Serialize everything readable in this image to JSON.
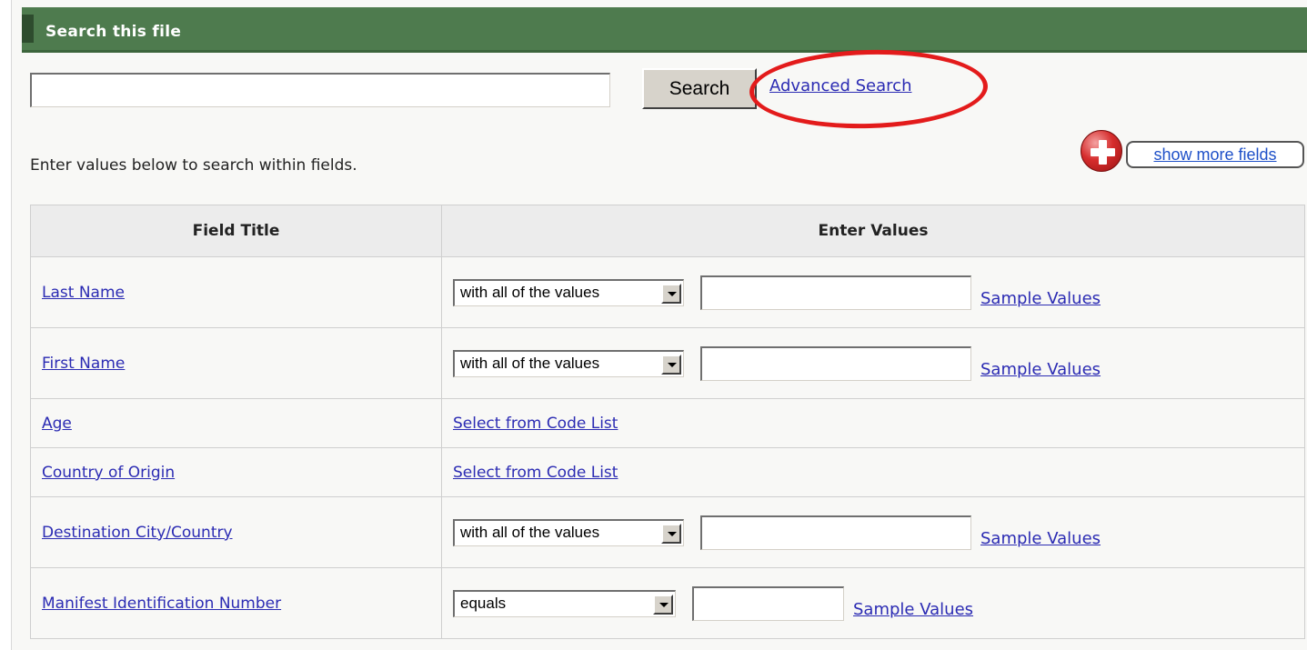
{
  "header": {
    "title": "Search this file"
  },
  "search": {
    "value": "",
    "button_label": "Search",
    "advanced_link": "Advanced Search"
  },
  "show_more": {
    "label": "show more fields"
  },
  "instructions": "Enter values below to search within fields.",
  "table": {
    "headers": [
      "Field Title",
      "Enter Values"
    ],
    "rows": [
      {
        "title": "Last Name",
        "operator": "with all of the values",
        "value": "",
        "sample": "Sample Values"
      },
      {
        "title": "First Name",
        "operator": "with all of the values",
        "value": "",
        "sample": "Sample Values"
      },
      {
        "title": "Age",
        "link": "Select from Code List"
      },
      {
        "title": "Country of Origin",
        "link": "Select from Code List"
      },
      {
        "title": "Destination City/Country",
        "operator": "with all of the values",
        "value": "",
        "sample": "Sample Values"
      },
      {
        "title": "Manifest Identification Number",
        "operator": "equals",
        "value": "",
        "sample": "Sample Values"
      }
    ]
  },
  "colors": {
    "header_bg": "#4e7b4e",
    "link": "#2b2bb3",
    "annotation_circle": "#e31b1b"
  },
  "icons": {
    "show_more": "plus-circle-icon",
    "select": "chevron-down-icon"
  }
}
